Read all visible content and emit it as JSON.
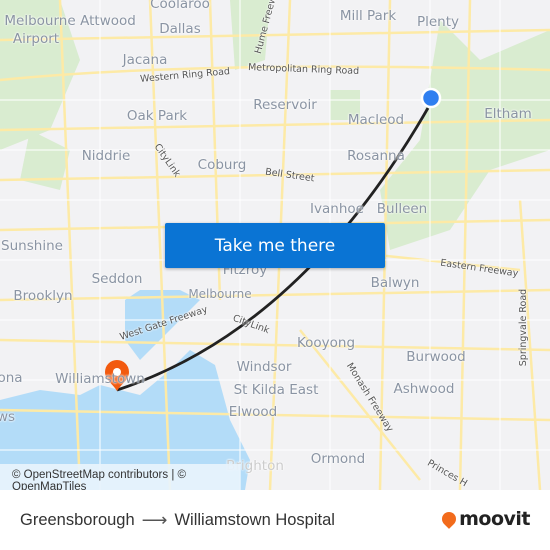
{
  "map": {
    "places": [
      "Coolaroo",
      "Mill Park",
      "Plenty",
      "Melbourne",
      "Attwood",
      "Airport",
      "Dallas",
      "Jacana",
      "Reservoir",
      "Macleod",
      "Eltham",
      "Oak Park",
      "Niddrie",
      "Coburg",
      "Rosanna",
      "Ivanhoe",
      "Bulleen",
      "Sunshine",
      "Seddon",
      "Fitzroy",
      "Balwyn",
      "Brooklyn",
      "Melbourne",
      "Kooyong",
      "Burwood",
      "Windsor",
      "Williamstown",
      "St Kilda East",
      "Ashwood",
      "Elwood",
      "Ormond",
      "ona",
      "ws",
      "Brighton"
    ],
    "roads": [
      "Hume Freeway",
      "Western Ring Road",
      "Metropolitan Ring Road",
      "CityLink",
      "Bell Street",
      "Eastern Freeway",
      "Springvale Road",
      "West Gate Freeway",
      "CityLink",
      "Monash Freeway",
      "Princes H"
    ],
    "origin_marker": "blue-dot",
    "destination_marker": "orange-pin",
    "colors": {
      "route": "#222222",
      "origin": "#2f7ff0",
      "destination": "#f25a0f",
      "water": "#b3dcf8",
      "button": "#0a74d4"
    }
  },
  "cta": {
    "label": "Take me there"
  },
  "attribution": "© OpenStreetMap contributors | © OpenMapTiles",
  "footer": {
    "origin": "Greensborough",
    "arrow": "⟶",
    "destination": "Williamstown Hospital",
    "brand": "moovit"
  }
}
